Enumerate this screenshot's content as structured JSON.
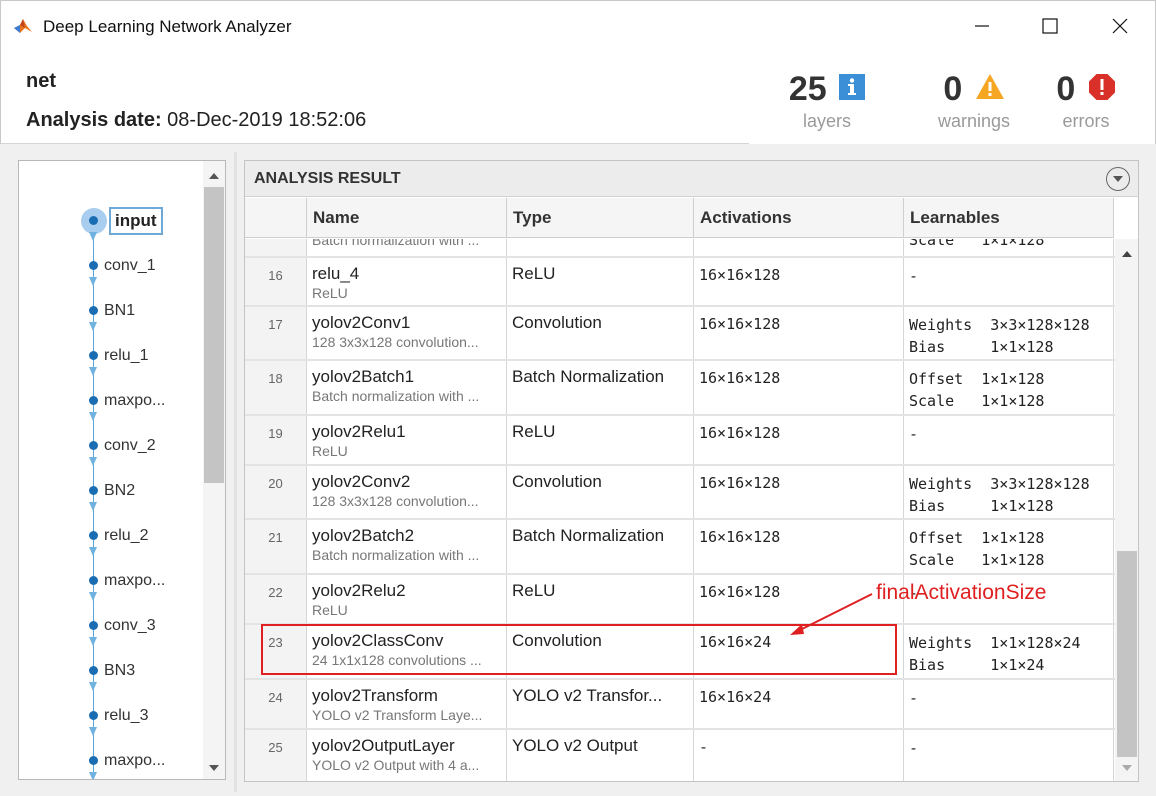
{
  "window": {
    "title": "Deep Learning Network Analyzer",
    "icon": "matlab-logo-icon"
  },
  "header": {
    "net_name": "net",
    "analysis_date_label": "Analysis date:",
    "analysis_date_value": "08-Dec-2019 18:52:06",
    "stats": {
      "layers": {
        "count": "25",
        "label": "layers",
        "icon": "info-icon",
        "color": "#3b8fd6"
      },
      "warnings": {
        "count": "0",
        "label": "warnings",
        "icon": "warning-icon",
        "color": "#f5a623"
      },
      "errors": {
        "count": "0",
        "label": "errors",
        "icon": "error-icon",
        "color": "#d9302a"
      }
    }
  },
  "layer_graph": {
    "selected": "input",
    "nodes": [
      "input",
      "conv_1",
      "BN1",
      "relu_1",
      "maxpo...",
      "conv_2",
      "BN2",
      "relu_2",
      "maxpo...",
      "conv_3",
      "BN3",
      "relu_3",
      "maxpo..."
    ]
  },
  "analysis_result": {
    "title": "ANALYSIS RESULT",
    "columns": [
      "",
      "Name",
      "Type",
      "Activations",
      "Learnables"
    ],
    "partial_row": {
      "sub": "Batch normalization with ...",
      "learnables": "Scale   1×1×128"
    },
    "rows": [
      {
        "num": "16",
        "name": "relu_4",
        "desc": "ReLU",
        "type": "ReLU",
        "activations": "16×16×128",
        "learnables": "-"
      },
      {
        "num": "17",
        "name": "yolov2Conv1",
        "desc": "128 3x3x128 convolution...",
        "type": "Convolution",
        "activations": "16×16×128",
        "learnables": "Weights  3×3×128×128\nBias     1×1×128"
      },
      {
        "num": "18",
        "name": "yolov2Batch1",
        "desc": "Batch normalization with ...",
        "type": "Batch Normalization",
        "activations": "16×16×128",
        "learnables": "Offset  1×1×128\nScale   1×1×128"
      },
      {
        "num": "19",
        "name": "yolov2Relu1",
        "desc": "ReLU",
        "type": "ReLU",
        "activations": "16×16×128",
        "learnables": "-"
      },
      {
        "num": "20",
        "name": "yolov2Conv2",
        "desc": "128 3x3x128 convolution...",
        "type": "Convolution",
        "activations": "16×16×128",
        "learnables": "Weights  3×3×128×128\nBias     1×1×128"
      },
      {
        "num": "21",
        "name": "yolov2Batch2",
        "desc": "Batch normalization with ...",
        "type": "Batch Normalization",
        "activations": "16×16×128",
        "learnables": "Offset  1×1×128\nScale   1×1×128"
      },
      {
        "num": "22",
        "name": "yolov2Relu2",
        "desc": "ReLU",
        "type": "ReLU",
        "activations": "16×16×128",
        "learnables": "-"
      },
      {
        "num": "23",
        "name": "yolov2ClassConv",
        "desc": "24 1x1x128 convolutions ...",
        "type": "Convolution",
        "activations": "16×16×24",
        "learnables": "Weights  1×1×128×24\nBias     1×1×24"
      },
      {
        "num": "24",
        "name": "yolov2Transform",
        "desc": "YOLO v2 Transform Laye...",
        "type": "YOLO v2 Transfor...",
        "activations": "16×16×24",
        "learnables": "-"
      },
      {
        "num": "25",
        "name": "yolov2OutputLayer",
        "desc": "YOLO v2 Output with 4 a...",
        "type": "YOLO v2 Output",
        "activations": "-",
        "learnables": "-"
      }
    ]
  },
  "annotation": {
    "text": "finalActivationSize",
    "color": "#e02020"
  }
}
